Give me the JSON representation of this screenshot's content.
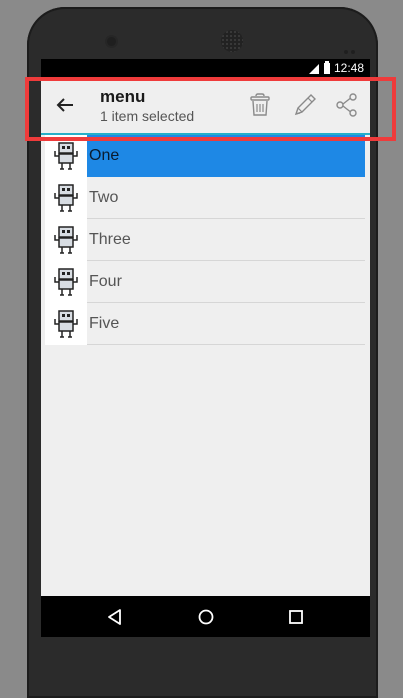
{
  "status_bar": {
    "time": "12:48"
  },
  "action_bar": {
    "title": "menu",
    "subtitle": "1 item selected",
    "icons": [
      "back-arrow-icon",
      "trash-icon",
      "pencil-icon",
      "share-icon"
    ]
  },
  "list": {
    "items": [
      {
        "label": "One",
        "selected": true
      },
      {
        "label": "Two",
        "selected": false
      },
      {
        "label": "Three",
        "selected": false
      },
      {
        "label": "Four",
        "selected": false
      },
      {
        "label": "Five",
        "selected": false
      }
    ]
  },
  "nav_bar": {
    "icons": [
      "nav-back-icon",
      "nav-home-icon",
      "nav-recent-icon"
    ]
  },
  "colors": {
    "accent": "#26b0c8",
    "selected_row": "#1e88e5",
    "highlight_box": "#ef3b3b"
  }
}
